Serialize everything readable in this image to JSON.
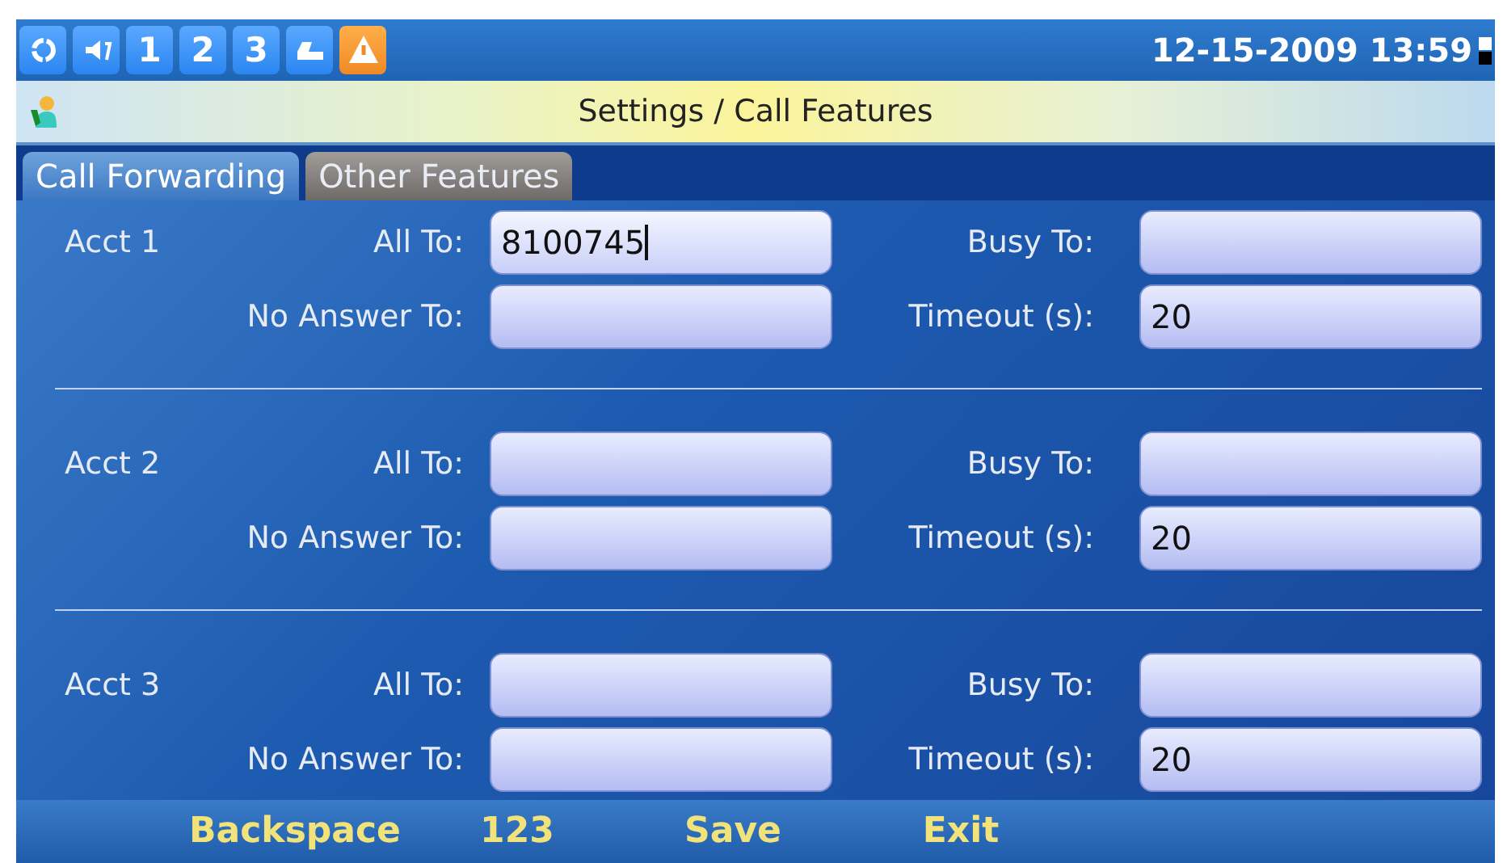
{
  "status_bar": {
    "line_indicators": [
      {
        "label": "1"
      },
      {
        "label": "2"
      },
      {
        "label": "3"
      }
    ],
    "datetime": "12-15-2009 13:59"
  },
  "title_bar": {
    "title": "Settings / Call Features"
  },
  "tabs": [
    {
      "label": "Call Forwarding",
      "selected": true
    },
    {
      "label": "Other Features",
      "selected": false
    }
  ],
  "accounts": [
    {
      "name": "Acct 1",
      "all_to": {
        "label": "All To:",
        "value": "8100745",
        "focused": true
      },
      "busy_to": {
        "label": "Busy To:",
        "focused": false
      },
      "no_answer_to": {
        "label": "No Answer To:",
        "focused": false
      },
      "timeout": {
        "label": "Timeout (s):",
        "value": "20",
        "focused": false
      }
    },
    {
      "name": "Acct 2",
      "all_to": {
        "label": "All To:",
        "focused": false
      },
      "busy_to": {
        "label": "Busy To:",
        "focused": false
      },
      "no_answer_to": {
        "label": "No Answer To:",
        "focused": false
      },
      "timeout": {
        "label": "Timeout (s):",
        "value": "20",
        "focused": false
      }
    },
    {
      "name": "Acct 3",
      "all_to": {
        "label": "All To:",
        "focused": false
      },
      "busy_to": {
        "label": "Busy To:",
        "focused": false
      },
      "no_answer_to": {
        "label": "No Answer To:",
        "focused": false
      },
      "timeout": {
        "label": "Timeout (s):",
        "value": "20",
        "focused": false
      }
    }
  ],
  "softkeys": [
    {
      "label": "Backspace"
    },
    {
      "label": "123"
    },
    {
      "label": "Save"
    },
    {
      "label": "Exit"
    }
  ]
}
